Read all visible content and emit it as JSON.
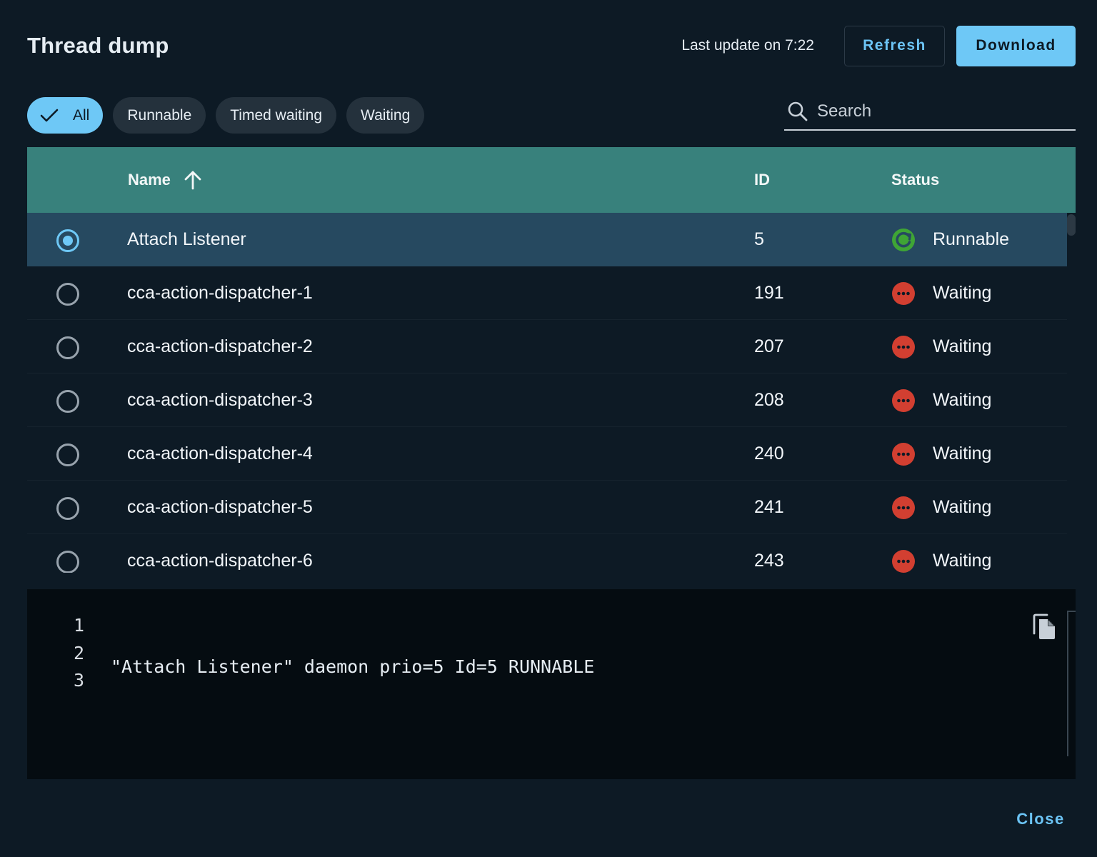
{
  "header": {
    "title": "Thread dump",
    "last_update": "Last update on 7:22",
    "refresh_label": "Refresh",
    "download_label": "Download"
  },
  "filters": [
    {
      "label": "All",
      "active": true
    },
    {
      "label": "Runnable",
      "active": false
    },
    {
      "label": "Timed waiting",
      "active": false
    },
    {
      "label": "Waiting",
      "active": false
    }
  ],
  "search": {
    "placeholder": "Search",
    "value": "",
    "icon": "search-icon"
  },
  "table": {
    "columns": {
      "name": "Name",
      "id": "ID",
      "status": "Status"
    },
    "sort": {
      "column": "Name",
      "direction": "ascending",
      "icon": "arrow-up-icon"
    },
    "rows": [
      {
        "name": "Attach Listener",
        "id": "5",
        "status": "Runnable",
        "selected": true
      },
      {
        "name": "cca-action-dispatcher-1",
        "id": "191",
        "status": "Waiting",
        "selected": false
      },
      {
        "name": "cca-action-dispatcher-2",
        "id": "207",
        "status": "Waiting",
        "selected": false
      },
      {
        "name": "cca-action-dispatcher-3",
        "id": "208",
        "status": "Waiting",
        "selected": false
      },
      {
        "name": "cca-action-dispatcher-4",
        "id": "240",
        "status": "Waiting",
        "selected": false
      },
      {
        "name": "cca-action-dispatcher-5",
        "id": "241",
        "status": "Waiting",
        "selected": false
      },
      {
        "name": "cca-action-dispatcher-6",
        "id": "243",
        "status": "Waiting",
        "selected": false
      }
    ]
  },
  "code": {
    "line_numbers": [
      "1",
      "2",
      "3"
    ],
    "lines": [
      "\"Attach Listener\" daemon prio=5 Id=5 RUNNABLE",
      "",
      ""
    ],
    "copy_icon": "copy-icon"
  },
  "footer": {
    "close_label": "Close"
  },
  "colors": {
    "background": "#0d1a25",
    "accent": "#6ec8f6",
    "header_row": "#38817c",
    "selected_row": "#264960",
    "runnable": "#3fa535",
    "waiting": "#d23f31"
  }
}
